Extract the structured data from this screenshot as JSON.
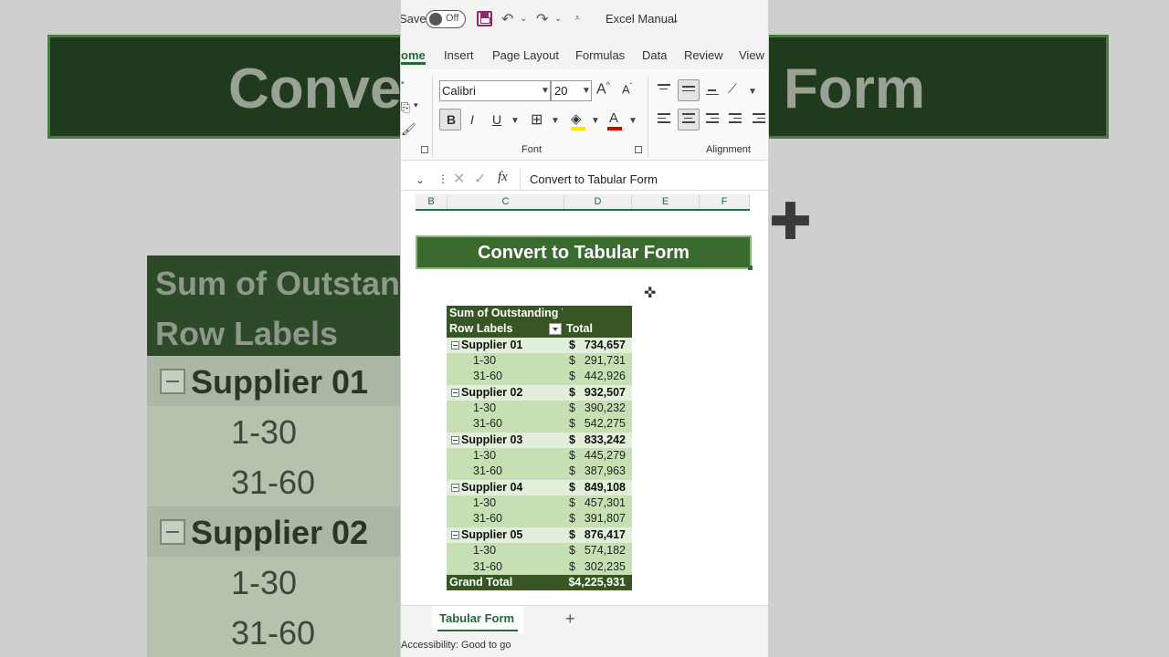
{
  "background": {
    "title_left": "Conve",
    "title_right": "Form",
    "head_line1": "Sum of Outstan",
    "head_line2": "Row Labels",
    "rows": [
      {
        "type": "sup",
        "label": "Supplier 01"
      },
      {
        "type": "det",
        "label": "1-30"
      },
      {
        "type": "det",
        "label": "31-60"
      },
      {
        "type": "sup",
        "label": "Supplier 02"
      },
      {
        "type": "det",
        "label": "1-30"
      },
      {
        "type": "det",
        "label": "31-60"
      }
    ]
  },
  "qat": {
    "save_label": "Save",
    "autosave_state": "Off",
    "title": "Excel Manual"
  },
  "tabs": [
    "ome",
    "Insert",
    "Page Layout",
    "Formulas",
    "Data",
    "Review",
    "View"
  ],
  "ribbon": {
    "font_name": "Calibri",
    "font_size": "20",
    "bold": "B",
    "italic": "I",
    "underline": "U",
    "font_group": "Font",
    "alignment_group": "Alignment"
  },
  "formula_bar": {
    "content": "Convert to Tabular Form"
  },
  "columns": [
    "B",
    "C",
    "D",
    "E",
    "F"
  ],
  "sheet": {
    "title": "Convert to Tabular Form",
    "pivot": {
      "header_line1": "Sum of Outstanding Va",
      "row_labels": "Row Labels",
      "total_header": "Total",
      "rows": [
        {
          "type": "sup",
          "label": "Supplier 01",
          "value": "734,657"
        },
        {
          "type": "det",
          "label": "1-30",
          "value": "291,731"
        },
        {
          "type": "det",
          "label": "31-60",
          "value": "442,926"
        },
        {
          "type": "sup",
          "label": "Supplier 02",
          "value": "932,507"
        },
        {
          "type": "det",
          "label": "1-30",
          "value": "390,232"
        },
        {
          "type": "det",
          "label": "31-60",
          "value": "542,275"
        },
        {
          "type": "sup",
          "label": "Supplier 03",
          "value": "833,242"
        },
        {
          "type": "det",
          "label": "1-30",
          "value": "445,279"
        },
        {
          "type": "det",
          "label": "31-60",
          "value": "387,963"
        },
        {
          "type": "sup",
          "label": "Supplier 04",
          "value": "849,108"
        },
        {
          "type": "det",
          "label": "1-30",
          "value": "457,301"
        },
        {
          "type": "det",
          "label": "31-60",
          "value": "391,807"
        },
        {
          "type": "sup",
          "label": "Supplier 05",
          "value": "876,417"
        },
        {
          "type": "det",
          "label": "1-30",
          "value": "574,182"
        },
        {
          "type": "det",
          "label": "31-60",
          "value": "302,235"
        }
      ],
      "currency": "$",
      "grand_total_label": "Grand Total",
      "grand_total_value": "$4,225,931"
    }
  },
  "sheet_tabs": {
    "active": "Tabular Form",
    "add": "+"
  },
  "status": {
    "text": "Accessibility: Good to go"
  },
  "colors": {
    "excel_green": "#217346",
    "pivot_header": "#375623",
    "pivot_subtotal": "#e2efda",
    "pivot_detail": "#c6e0b4",
    "title_banner": "#3a6a2e"
  }
}
